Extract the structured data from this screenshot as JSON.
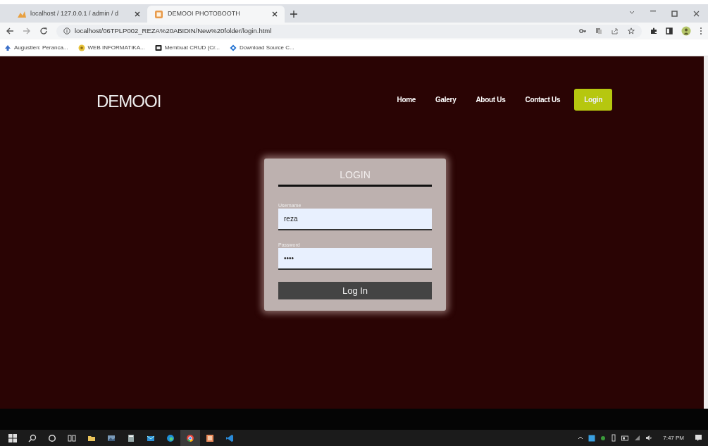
{
  "browser": {
    "tabs": [
      {
        "title": "localhost / 127.0.0.1 / admin / d",
        "selected": false
      },
      {
        "title": "DEMOOI PHOTOBOOTH",
        "selected": true
      }
    ],
    "address": "localhost/06TPLP002_REZA%20ABIDIN/New%20folder/login.html",
    "bookmarks": [
      "Augustien: Peranca...",
      "WEB INFORMATIKA...",
      "Membuat CRUD (Cr...",
      "Download Source C..."
    ]
  },
  "page": {
    "brand": "DEMOOI",
    "nav": [
      {
        "label": "Home",
        "selected": false
      },
      {
        "label": "Galery",
        "selected": false
      },
      {
        "label": "About Us",
        "selected": false
      },
      {
        "label": "Contact Us",
        "selected": false
      },
      {
        "label": "Login",
        "selected": true
      }
    ],
    "login": {
      "title": "LOGIN",
      "fields": [
        {
          "label": "Username",
          "value": "reza"
        },
        {
          "label": "Password",
          "value": "••••"
        }
      ],
      "button": "Log In"
    }
  },
  "taskbar": {
    "apps": [
      {
        "selected": false
      },
      {
        "selected": false
      },
      {
        "selected": false
      },
      {
        "selected": false
      },
      {
        "selected": false
      },
      {
        "selected": true
      },
      {
        "selected": false
      },
      {
        "selected": false
      }
    ],
    "clock": "7:47 PM"
  }
}
